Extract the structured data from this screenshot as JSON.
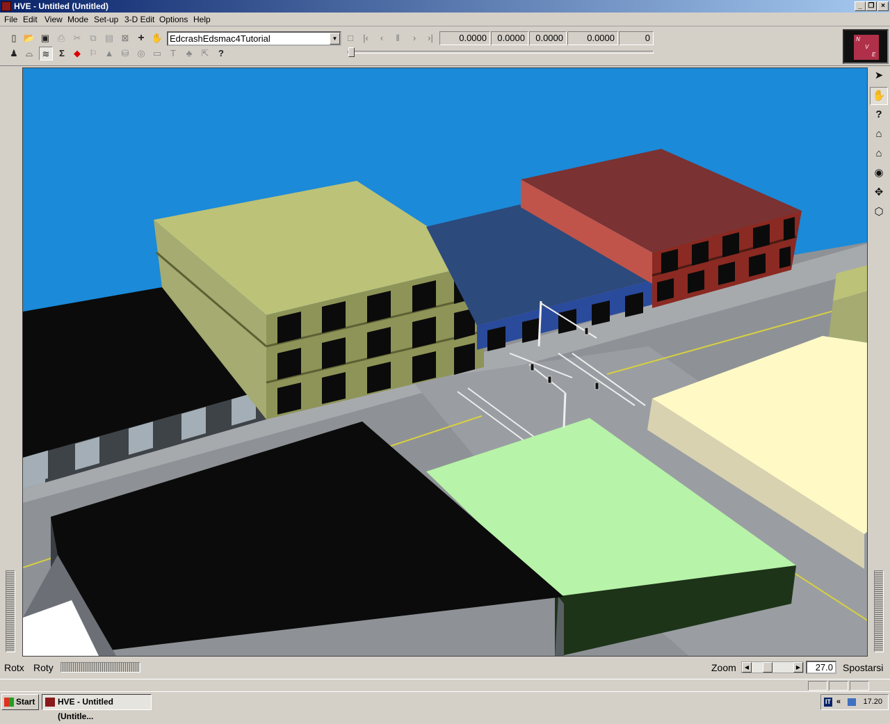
{
  "window": {
    "title": "HVE - Untitled (Untitled)",
    "controls": [
      "minimize",
      "restore",
      "close"
    ]
  },
  "menu": {
    "items": [
      "File",
      "Edit",
      "View",
      "Mode",
      "Set-up",
      "3-D Edit",
      "Options",
      "Help"
    ]
  },
  "toolbar": {
    "event_combo_value": "EdcrashEdsmac4Tutorial",
    "playback_icons": [
      "stop-icon",
      "first-frame-icon",
      "previous-frame-icon",
      "pause-icon",
      "next-frame-icon",
      "last-frame-icon"
    ],
    "readouts": [
      "0.0000",
      "0.0000",
      "0.0000",
      "0.0000",
      "0"
    ],
    "time_slider_value": 0
  },
  "nav_cube": {
    "labels": [
      "N",
      "V",
      "E"
    ]
  },
  "right_tools": [
    "select-arrow-icon",
    "hand-pan-icon",
    "help-question-icon",
    "home-view-icon",
    "home-set-icon",
    "eye-view-icon",
    "move-crosshair-icon",
    "perspective-box-icon"
  ],
  "status": {
    "rotx_label": "Rotx",
    "roty_label": "Roty",
    "zoom_label": "Zoom",
    "zoom_value": "27.0",
    "mode_label": "Spostarsi"
  },
  "taskbar": {
    "start_label": "Start",
    "task_label": "HVE - Untitled (Untitle...",
    "tray_lang": "IT",
    "tray_chevron": "«",
    "clock": "17.20"
  },
  "colors": {
    "sky": "#1b8ad8",
    "road": "#8e9296",
    "sidewalk": "#a7aaad",
    "building_yellow_roof": "#bcc277",
    "building_blue": "#2c4a7c",
    "building_red_roof": "#7a3232",
    "building_green_roof": "#b7f3a8",
    "building_cream_roof": "#fff9c6",
    "building_black": "#0b0b0b",
    "lane_marking": "#d8d040"
  }
}
